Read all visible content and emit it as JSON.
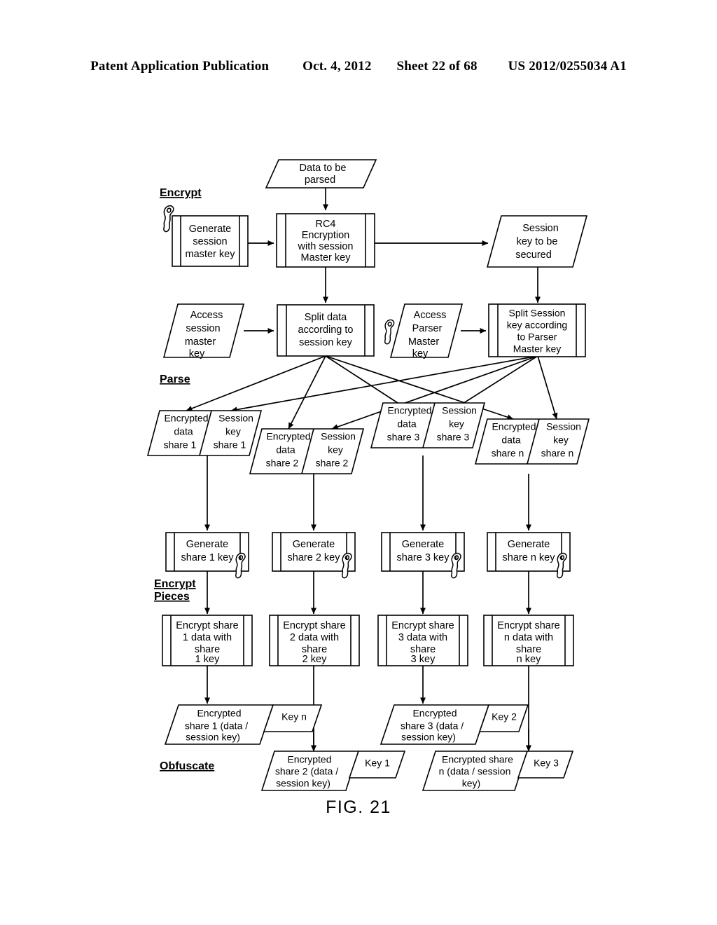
{
  "header": {
    "publication": "Patent Application Publication",
    "date": "Oct. 4, 2012",
    "sheet": "Sheet 22 of 68",
    "number": "US 2012/0255034 A1"
  },
  "figure": {
    "caption": "FIG. 21"
  },
  "sections": {
    "encrypt": "Encrypt",
    "parse": "Parse",
    "encrypt_pieces_line1": "Encrypt",
    "encrypt_pieces_line2": "Pieces",
    "obfuscate": "Obfuscate"
  },
  "nodes": {
    "data_to_be_parsed": [
      "Data to be",
      "parsed"
    ],
    "generate_session_master_key": [
      "Generate",
      "session",
      "master key"
    ],
    "rc4_encryption": [
      "RC4",
      "Encryption",
      "with session",
      "Master key"
    ],
    "session_key_to_be_secured": [
      "Session",
      "key to be",
      "secured"
    ],
    "access_session_master_key": [
      "Access",
      "session",
      "master",
      "key"
    ],
    "split_data": [
      "Split data",
      "according to",
      "session key"
    ],
    "access_parser_master_key": [
      "Access",
      "Parser",
      "Master",
      "key"
    ],
    "split_session_key": [
      "Split Session",
      "key according",
      "to Parser",
      "Master key"
    ],
    "shares": [
      {
        "data": [
          "Encrypted",
          "data",
          "share 1"
        ],
        "key": [
          "Session",
          "key",
          "share 1"
        ]
      },
      {
        "data": [
          "Encrypted",
          "data",
          "share 2"
        ],
        "key": [
          "Session",
          "key",
          "share 2"
        ]
      },
      {
        "data": [
          "Encrypted",
          "data",
          "share 3"
        ],
        "key": [
          "Session",
          "key",
          "share 3"
        ]
      },
      {
        "data": [
          "Encrypted",
          "data",
          "share n"
        ],
        "key": [
          "Session",
          "key",
          "share n"
        ]
      }
    ],
    "generate_share_keys": [
      [
        "Generate",
        "share 1 key"
      ],
      [
        "Generate",
        "share 2 key"
      ],
      [
        "Generate",
        "share 3 key"
      ],
      [
        "Generate",
        "share n key"
      ]
    ],
    "encrypt_shares": [
      [
        "Encrypt share",
        "1 data with",
        "share",
        "1 key"
      ],
      [
        "Encrypt share",
        "2 data with",
        "share",
        "2 key"
      ],
      [
        "Encrypt share",
        "3 data with",
        "share",
        "3 key"
      ],
      [
        "Encrypt share",
        "n data with",
        "share",
        "n key"
      ]
    ],
    "outputs": [
      {
        "body": [
          "Encrypted",
          "share 1 (data /",
          "session key)"
        ],
        "key": "Key n"
      },
      {
        "body": [
          "Encrypted",
          "share 2 (data /",
          "session key)"
        ],
        "key": "Key 1"
      },
      {
        "body": [
          "Encrypted",
          "share 3 (data /",
          "session key)"
        ],
        "key": "Key 2"
      },
      {
        "body": [
          "Encrypted share",
          "n (data / session",
          "key)"
        ],
        "key": "Key 3"
      }
    ]
  },
  "icons": {
    "key_glyph": "key-icon",
    "arrow_glyph": "arrowhead"
  },
  "colors": {
    "ink": "#000000",
    "paper": "#ffffff"
  }
}
